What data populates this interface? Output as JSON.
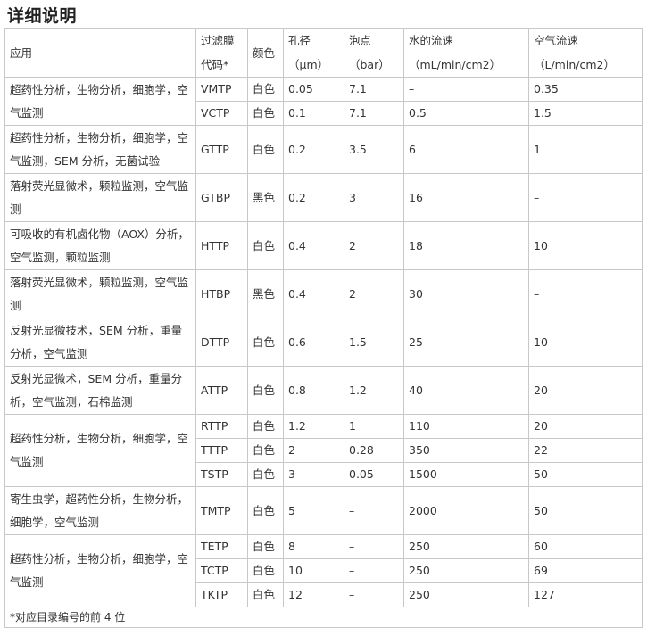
{
  "title": "详细说明",
  "headers": {
    "application": "应用",
    "code": "过滤膜代码*",
    "color": "颜色",
    "pore": "孔径（μm）",
    "bubble": "泡点（bar）",
    "water": "水的流速（mL/min/cm2）",
    "air": "空气流速（L/min/cm2）"
  },
  "groups": [
    {
      "application": "超药性分析，生物分析，细胞学，空气监测",
      "rows": [
        {
          "code": "VMTP",
          "color": "白色",
          "pore": "0.05",
          "bubble": "7.1",
          "water": "–",
          "air": "0.35"
        },
        {
          "code": "VCTP",
          "color": "白色",
          "pore": "0.1",
          "bubble": "7.1",
          "water": "0.5",
          "air": "1.5"
        }
      ]
    },
    {
      "application": "超药性分析，生物分析，细胞学，空气监测，SEM 分析，无菌试验",
      "rows": [
        {
          "code": "GTTP",
          "color": "白色",
          "pore": "0.2",
          "bubble": "3.5",
          "water": "6",
          "air": "1"
        }
      ]
    },
    {
      "application": "落射荧光显微术，颗粒监测，空气监测",
      "rows": [
        {
          "code": "GTBP",
          "color": "黑色",
          "pore": "0.2",
          "bubble": "3",
          "water": "16",
          "air": "–"
        }
      ]
    },
    {
      "application": "可吸收的有机卤化物（AOX）分析，空气监测，颗粒监测",
      "rows": [
        {
          "code": "HTTP",
          "color": "白色",
          "pore": "0.4",
          "bubble": "2",
          "water": "18",
          "air": "10"
        }
      ]
    },
    {
      "application": "落射荧光显微术，颗粒监测，空气监测",
      "rows": [
        {
          "code": "HTBP",
          "color": "黑色",
          "pore": "0.4",
          "bubble": "2",
          "water": "30",
          "air": "–"
        }
      ]
    },
    {
      "application": "反射光显微技术，SEM 分析，重量分析，空气监测",
      "rows": [
        {
          "code": "DTTP",
          "color": "白色",
          "pore": "0.6",
          "bubble": "1.5",
          "water": "25",
          "air": "10"
        }
      ]
    },
    {
      "application": "反射光显微术，SEM 分析，重量分析，空气监测，石棉监测",
      "rows": [
        {
          "code": "ATTP",
          "color": "白色",
          "pore": "0.8",
          "bubble": "1.2",
          "water": "40",
          "air": "20"
        }
      ]
    },
    {
      "application": "超药性分析，生物分析，细胞学，空气监测",
      "rows": [
        {
          "code": "RTTP",
          "color": "白色",
          "pore": "1.2",
          "bubble": "1",
          "water": "110",
          "air": "20"
        },
        {
          "code": "TTTP",
          "color": "白色",
          "pore": "2",
          "bubble": "0.28",
          "water": "350",
          "air": "22"
        },
        {
          "code": "TSTP",
          "color": "白色",
          "pore": "3",
          "bubble": "0.05",
          "water": "1500",
          "air": "50"
        }
      ]
    },
    {
      "application": "寄生虫学，超药性分析，生物分析，细胞学，空气监测",
      "rows": [
        {
          "code": "TMTP",
          "color": "白色",
          "pore": "5",
          "bubble": "–",
          "water": "2000",
          "air": "50"
        }
      ]
    },
    {
      "application": "超药性分析，生物分析，细胞学，空气监测",
      "rows": [
        {
          "code": "TETP",
          "color": "白色",
          "pore": "8",
          "bubble": "–",
          "water": "250",
          "air": "60"
        },
        {
          "code": "TCTP",
          "color": "白色",
          "pore": "10",
          "bubble": "–",
          "water": "250",
          "air": "69"
        },
        {
          "code": "TKTP",
          "color": "白色",
          "pore": "12",
          "bubble": "–",
          "water": "250",
          "air": "127"
        }
      ]
    }
  ],
  "footnote": "*对应目录编号的前 4 位"
}
